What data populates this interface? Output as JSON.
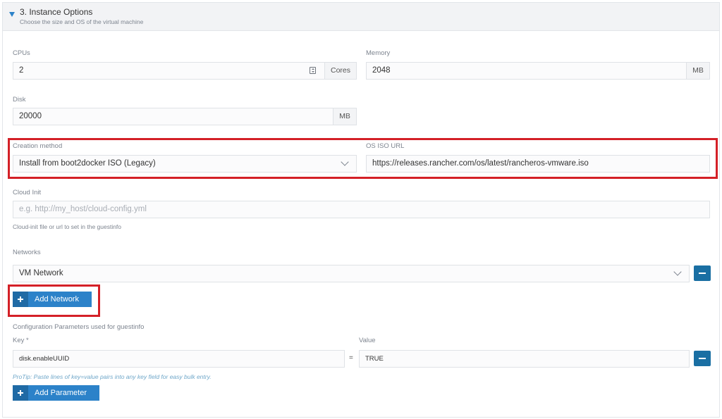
{
  "section": {
    "title": "3. Instance Options",
    "subtitle": "Choose the size and OS of the virtual machine"
  },
  "cpus": {
    "label": "CPUs",
    "value": "2",
    "unit": "Cores"
  },
  "memory": {
    "label": "Memory",
    "value": "2048",
    "unit": "MB"
  },
  "disk": {
    "label": "Disk",
    "value": "20000",
    "unit": "MB"
  },
  "creation_method": {
    "label": "Creation method",
    "value": "Install from boot2docker ISO (Legacy)"
  },
  "os_iso_url": {
    "label": "OS ISO URL",
    "value": "https://releases.rancher.com/os/latest/rancheros-vmware.iso"
  },
  "cloud_init": {
    "label": "Cloud Init",
    "placeholder": "e.g. http://my_host/cloud-config.yml",
    "help": "Cloud-init file or url to set in the guestinfo"
  },
  "networks": {
    "label": "Networks",
    "items": [
      "VM Network"
    ],
    "add_label": "Add Network"
  },
  "config_params": {
    "label": "Configuration Parameters used for guestinfo",
    "key_header": "Key *",
    "value_header": "Value",
    "rows": [
      {
        "key": "disk.enableUUID",
        "value": "TRUE"
      }
    ],
    "separator": "=",
    "protip": "ProTip: Paste lines of key=value pairs into any key field for easy bulk entry.",
    "add_label": "Add Parameter"
  },
  "colors": {
    "accent": "#2c82c9",
    "accent_dark": "#1a6fa3",
    "highlight": "#d42027"
  }
}
